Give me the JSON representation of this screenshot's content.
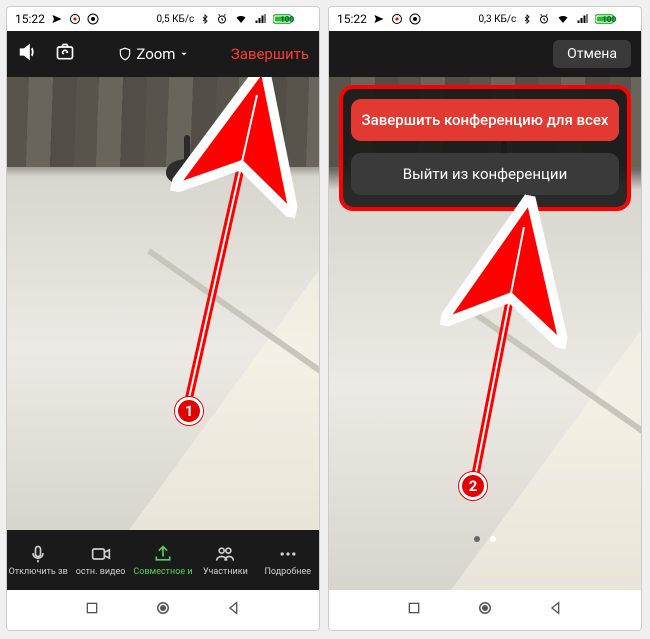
{
  "status": {
    "time": "15:22",
    "data_rate_a": "0,5 КБ/с",
    "data_rate_b": "0,3 КБ/с",
    "battery": "100"
  },
  "topbar": {
    "app_label": "Zoom",
    "end_label": "Завершить",
    "cancel_label": "Отмена"
  },
  "zoombar": {
    "mute": "Отключить зв",
    "video": "остн. видео",
    "share": "Совместное и",
    "participants": "Участники",
    "more": "Подробнее"
  },
  "dialog": {
    "end_all": "Завершить конференцию для всех",
    "leave": "Выйти из конференции"
  },
  "annotations": {
    "badge1": "1",
    "badge2": "2"
  }
}
